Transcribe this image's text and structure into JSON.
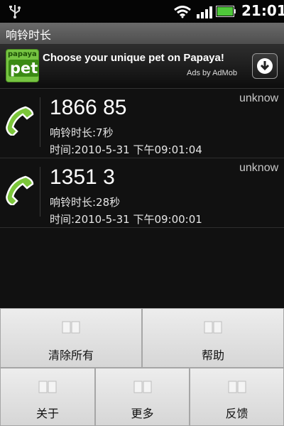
{
  "status_bar": {
    "time": "21:01"
  },
  "title": "响铃时长",
  "ad": {
    "logo_top": "papaya",
    "logo_main": "pet",
    "headline": "Choose your unique pet on Papaya!",
    "attribution": "Ads by AdMob"
  },
  "calls": [
    {
      "number": "1866        85",
      "status": "unknow",
      "ring": "响铃时长:7秒",
      "time": "时间:2010-5-31 下午09:01:04"
    },
    {
      "number": "1351          3",
      "status": "unknow",
      "ring": "响铃时长:28秒",
      "time": "时间:2010-5-31 下午09:00:01"
    }
  ],
  "menu": {
    "clear_all": "清除所有",
    "help": "帮助",
    "about": "关于",
    "more": "更多",
    "feedback": "反馈"
  },
  "colors": {
    "accent_green": "#7cc63a",
    "menu_bg": "#e4e4e4"
  }
}
